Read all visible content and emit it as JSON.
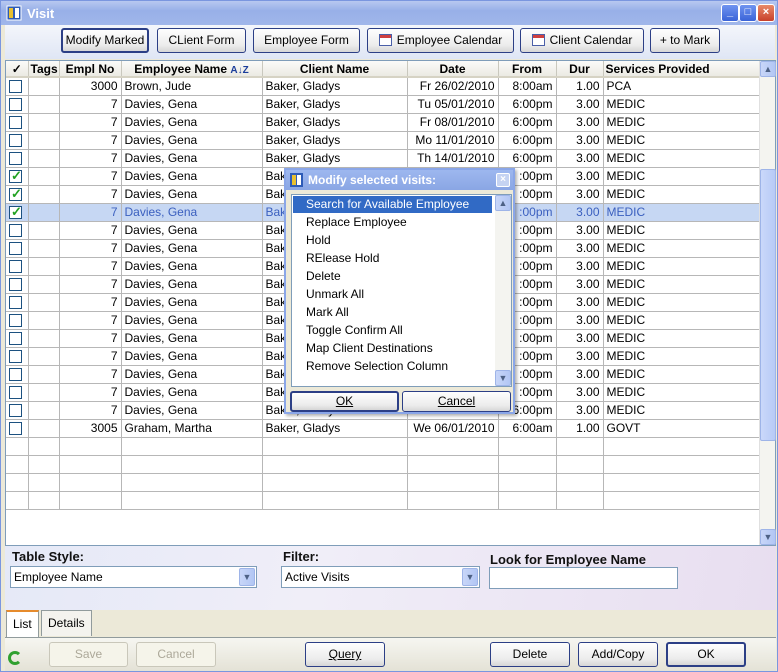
{
  "window": {
    "title": "Visit"
  },
  "toolbar": {
    "buttons": [
      {
        "label": "Modify Marked"
      },
      {
        "label": "CLient Form"
      },
      {
        "label": "Employee Form"
      },
      {
        "label": "Employee Calendar",
        "icon": "calendar-icon"
      },
      {
        "label": "Client Calendar",
        "icon": "calendar-icon"
      },
      {
        "label": "+ to Mark"
      }
    ]
  },
  "grid": {
    "columns": [
      "✓",
      "Tags",
      "Empl No",
      "Employee Name",
      "Client Name",
      "Date",
      "From",
      "Dur",
      "Services Provided"
    ],
    "sort_indicator": "A↓Z",
    "rows": [
      {
        "checked": false,
        "tags": "",
        "empl_no": "3000",
        "employee": "Brown, Jude",
        "client": "Baker, Gladys",
        "date": "Fr 26/02/2010",
        "from": "8:00am",
        "dur": "1.00",
        "service": "PCA"
      },
      {
        "checked": false,
        "tags": "",
        "empl_no": "7",
        "employee": "Davies, Gena",
        "client": "Baker, Gladys",
        "date": "Tu 05/01/2010",
        "from": "6:00pm",
        "dur": "3.00",
        "service": "MEDIC"
      },
      {
        "checked": false,
        "tags": "",
        "empl_no": "7",
        "employee": "Davies, Gena",
        "client": "Baker, Gladys",
        "date": "Fr 08/01/2010",
        "from": "6:00pm",
        "dur": "3.00",
        "service": "MEDIC"
      },
      {
        "checked": false,
        "tags": "",
        "empl_no": "7",
        "employee": "Davies, Gena",
        "client": "Baker, Gladys",
        "date": "Mo 11/01/2010",
        "from": "6:00pm",
        "dur": "3.00",
        "service": "MEDIC"
      },
      {
        "checked": false,
        "tags": "",
        "empl_no": "7",
        "employee": "Davies, Gena",
        "client": "Baker, Gladys",
        "date": "Th 14/01/2010",
        "from": "6:00pm",
        "dur": "3.00",
        "service": "MEDIC"
      },
      {
        "checked": true,
        "tags": "",
        "empl_no": "7",
        "employee": "Davies, Gena",
        "client": "Bak",
        "date": "",
        "from": ":00pm",
        "dur": "3.00",
        "service": "MEDIC"
      },
      {
        "checked": true,
        "tags": "",
        "empl_no": "7",
        "employee": "Davies, Gena",
        "client": "Bak",
        "date": "",
        "from": ":00pm",
        "dur": "3.00",
        "service": "MEDIC"
      },
      {
        "checked": true,
        "tags": "",
        "empl_no": "7",
        "employee": "Davies, Gena",
        "client": "Bak",
        "date": "",
        "from": ":00pm",
        "dur": "3.00",
        "service": "MEDIC",
        "selected": true
      },
      {
        "checked": false,
        "tags": "",
        "empl_no": "7",
        "employee": "Davies, Gena",
        "client": "Bak",
        "date": "",
        "from": ":00pm",
        "dur": "3.00",
        "service": "MEDIC"
      },
      {
        "checked": false,
        "tags": "",
        "empl_no": "7",
        "employee": "Davies, Gena",
        "client": "Bak",
        "date": "",
        "from": ":00pm",
        "dur": "3.00",
        "service": "MEDIC"
      },
      {
        "checked": false,
        "tags": "",
        "empl_no": "7",
        "employee": "Davies, Gena",
        "client": "Bak",
        "date": "",
        "from": ":00pm",
        "dur": "3.00",
        "service": "MEDIC"
      },
      {
        "checked": false,
        "tags": "",
        "empl_no": "7",
        "employee": "Davies, Gena",
        "client": "Bak",
        "date": "",
        "from": ":00pm",
        "dur": "3.00",
        "service": "MEDIC"
      },
      {
        "checked": false,
        "tags": "",
        "empl_no": "7",
        "employee": "Davies, Gena",
        "client": "Bak",
        "date": "",
        "from": ":00pm",
        "dur": "3.00",
        "service": "MEDIC"
      },
      {
        "checked": false,
        "tags": "",
        "empl_no": "7",
        "employee": "Davies, Gena",
        "client": "Bak",
        "date": "",
        "from": ":00pm",
        "dur": "3.00",
        "service": "MEDIC"
      },
      {
        "checked": false,
        "tags": "",
        "empl_no": "7",
        "employee": "Davies, Gena",
        "client": "Bak",
        "date": "",
        "from": ":00pm",
        "dur": "3.00",
        "service": "MEDIC"
      },
      {
        "checked": false,
        "tags": "",
        "empl_no": "7",
        "employee": "Davies, Gena",
        "client": "Bak",
        "date": "",
        "from": ":00pm",
        "dur": "3.00",
        "service": "MEDIC"
      },
      {
        "checked": false,
        "tags": "",
        "empl_no": "7",
        "employee": "Davies, Gena",
        "client": "Bak",
        "date": "",
        "from": ":00pm",
        "dur": "3.00",
        "service": "MEDIC"
      },
      {
        "checked": false,
        "tags": "",
        "empl_no": "7",
        "employee": "Davies, Gena",
        "client": "Bak",
        "date": "",
        "from": ":00pm",
        "dur": "3.00",
        "service": "MEDIC"
      },
      {
        "checked": false,
        "tags": "",
        "empl_no": "7",
        "employee": "Davies, Gena",
        "client": "Baker, Gladys",
        "date": "Su 28/02/2010",
        "from": "6:00pm",
        "dur": "3.00",
        "service": "MEDIC"
      },
      {
        "checked": false,
        "tags": "",
        "empl_no": "3005",
        "employee": "Graham, Martha",
        "client": "Baker, Gladys",
        "date": "We 06/01/2010",
        "from": "6:00am",
        "dur": "1.00",
        "service": "GOVT"
      }
    ],
    "empty_rows": 4
  },
  "filters": {
    "table_style_label": "Table Style:",
    "table_style_value": "Employee Name",
    "filter_label": "Filter:",
    "filter_value": "Active Visits",
    "look_for_label": "Look for Employee Name",
    "look_for_value": ""
  },
  "tabs": [
    {
      "label": "List",
      "active": true
    },
    {
      "label": "Details",
      "active": false
    }
  ],
  "bottom_buttons": {
    "save": "Save",
    "cancel": "Cancel",
    "query": "Query",
    "delete": "Delete",
    "addcopy": "Add/Copy",
    "ok": "OK"
  },
  "dialog": {
    "title": "Modify selected visits:",
    "items": [
      "Search for Available Employee",
      "Replace Employee",
      "Hold",
      "RElease Hold",
      "Delete",
      "Unmark All",
      "Mark All",
      "Toggle Confirm All",
      "Map Client Destinations",
      "Remove Selection Column"
    ],
    "selected_index": 0,
    "ok": "OK",
    "cancel": "Cancel"
  }
}
